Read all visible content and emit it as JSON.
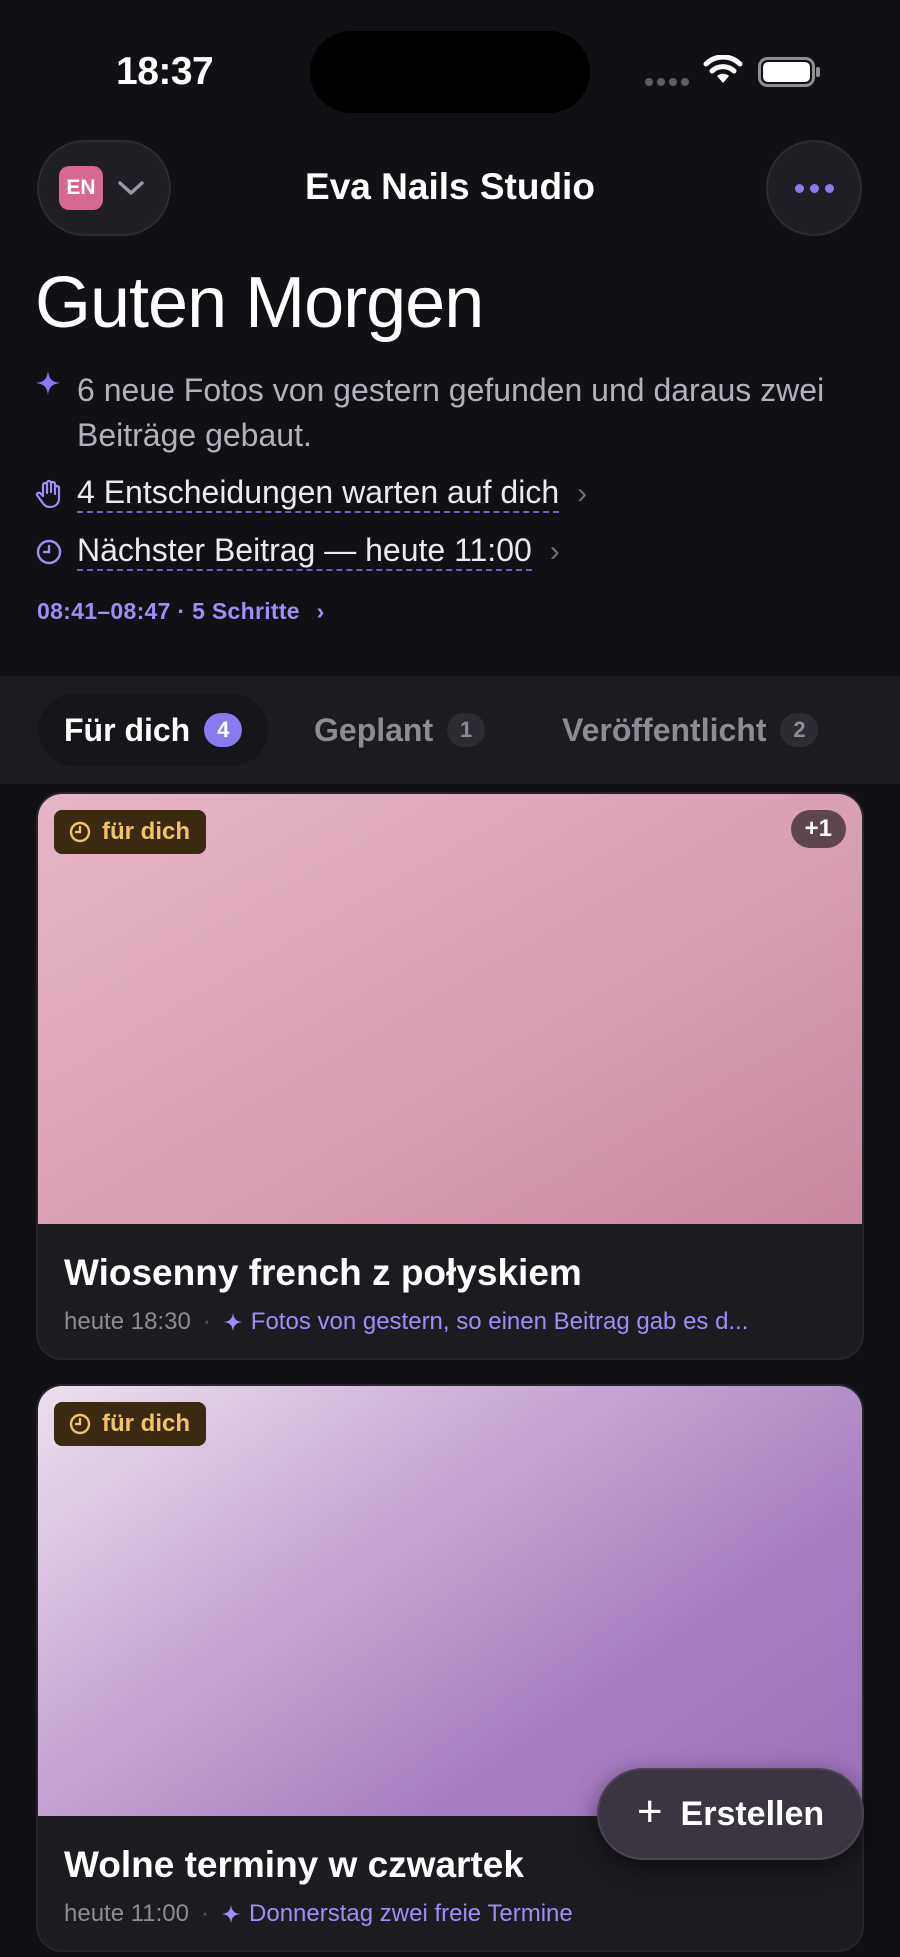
{
  "status_bar": {
    "time": "18:37"
  },
  "header": {
    "language_code": "EN",
    "title": "Eva Nails Studio"
  },
  "greeting": {
    "title": "Guten Morgen",
    "summary": "6 neue Fotos von gestern gefunden und daraus zwei Beiträge gebaut.",
    "decisions_link": "4 Entscheidungen warten auf dich",
    "next_post_link": "Nächster Beitrag — heute 11:00",
    "timeline": "08:41–08:47 · 5 Schritte"
  },
  "tabs": [
    {
      "label": "Für dich",
      "count": "4",
      "active": true
    },
    {
      "label": "Geplant",
      "count": "1",
      "active": false
    },
    {
      "label": "Veröffentlicht",
      "count": "2",
      "active": false
    }
  ],
  "cards": [
    {
      "chip": "für dich",
      "extra_count": "+1",
      "title": "Wiosenny french z połyskiem",
      "time": "heute 18:30",
      "reason": "Fotos von gestern, so einen Beitrag gab es d..."
    },
    {
      "chip": "für dich",
      "title": "Wolne terminy w czwartek",
      "time": "heute 11:00",
      "reason": "Donnerstag zwei freie Termine"
    }
  ],
  "fab": {
    "label": "Erstellen"
  },
  "colors": {
    "background": "#111014",
    "accent": "#8a7af2",
    "language_badge": "#d76793",
    "chip_text": "#f2c466"
  }
}
